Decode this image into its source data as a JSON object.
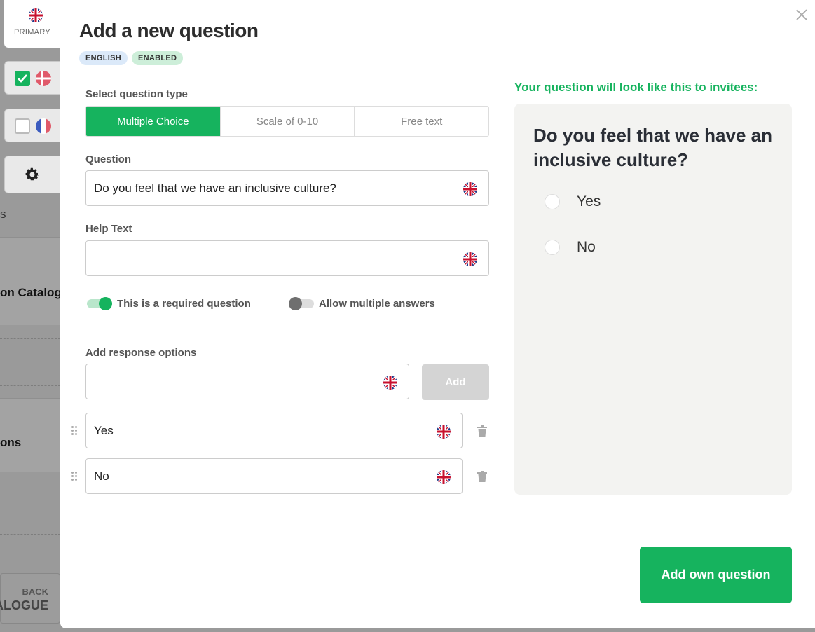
{
  "background": {
    "labels": [
      "on Catalogu",
      "ons"
    ],
    "back_small": "BACK",
    "back_big": "ALOGUE",
    "letter": "s"
  },
  "languages": {
    "primary_label": "PRIMARY",
    "items": [
      {
        "flag": "denmark-flag-icon",
        "checked": true
      },
      {
        "flag": "france-flag-icon",
        "checked": false
      }
    ]
  },
  "modal": {
    "title": "Add a new question",
    "badges": [
      "ENGLISH",
      "ENABLED"
    ],
    "question_type_label": "Select question type",
    "question_types": [
      "Multiple Choice",
      "Scale of 0-10",
      "Free text"
    ],
    "active_type": "Multiple Choice",
    "question_label": "Question",
    "question_value": "Do you feel that we have an inclusive culture?",
    "help_label": "Help Text",
    "help_value": "",
    "required_toggle": {
      "label": "This is a required question",
      "on": true
    },
    "multiple_toggle": {
      "label": "Allow multiple answers",
      "on": false
    },
    "response_label": "Add response options",
    "response_input_value": "",
    "add_button": "Add",
    "options": [
      "Yes",
      "No"
    ],
    "submit_button": "Add own question"
  },
  "preview": {
    "title": "Your question will look like this to invitees:",
    "question": "Do you feel that we have an inclusive culture?",
    "options": [
      "Yes",
      "No"
    ]
  },
  "colors": {
    "accent": "#16b35e",
    "badge_english": "#dbe9f9",
    "badge_enabled": "#cdeed9",
    "preview_bg": "#f3f3f1"
  }
}
